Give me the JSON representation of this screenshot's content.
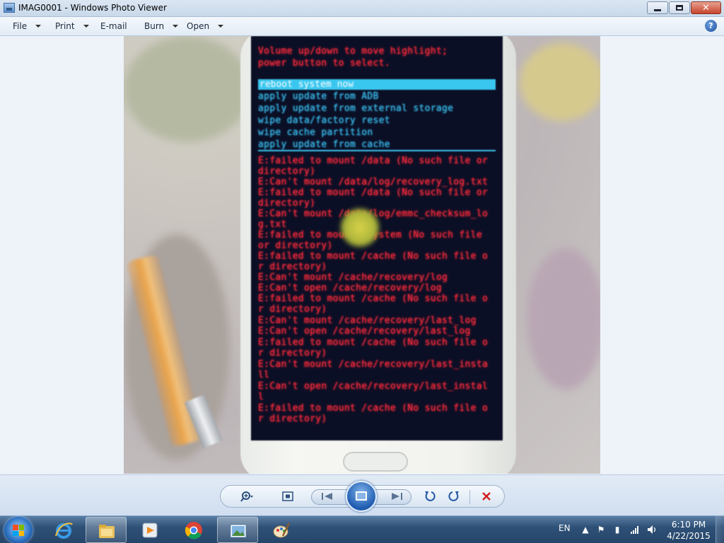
{
  "window": {
    "title": "IMAG0001 - Windows Photo Viewer",
    "icon": "photo-viewer-icon"
  },
  "menu": {
    "items": [
      {
        "label": "File",
        "has_dropdown": true
      },
      {
        "label": "Print",
        "has_dropdown": true
      },
      {
        "label": "E-mail",
        "has_dropdown": false
      },
      {
        "label": "Burn",
        "has_dropdown": true
      },
      {
        "label": "Open",
        "has_dropdown": true
      }
    ],
    "help_glyph": "?"
  },
  "photo": {
    "instructions": [
      "Volume up/down to move highlight;",
      "power button to select."
    ],
    "options": [
      "reboot system now",
      "apply update from ADB",
      "apply update from external storage",
      "wipe data/factory reset",
      "wipe cache partition",
      "apply update from cache"
    ],
    "selected_index": 0,
    "log": [
      "E:failed to mount /data (No such file or",
      "directory)",
      "E:Can't mount /data/log/recovery_log.txt",
      "E:failed to mount /data (No such file or",
      "directory)",
      "E:Can't mount /data/log/emmc_checksum_lo",
      "g.txt",
      "E:failed to mount /system (No such file",
      "or directory)",
      "E:failed to mount /cache (No such file o",
      "r directory)",
      "E:Can't mount /cache/recovery/log",
      "E:Can't open /cache/recovery/log",
      "E:failed to mount /cache (No such file o",
      "r directory)",
      "E:Can't mount /cache/recovery/last_log",
      "E:Can't open /cache/recovery/last_log",
      "E:failed to mount /cache (No such file o",
      "r directory)",
      "E:Can't mount /cache/recovery/last_insta",
      "ll",
      "E:Can't open /cache/recovery/last_instal",
      "l",
      "E:failed to mount /cache (No such file o",
      "r directory)"
    ],
    "colors": {
      "menu_text": "#37b8e8",
      "error_text": "#ff2a3a",
      "highlight": "#3ac7ef"
    }
  },
  "controls": {
    "zoom": "zoom-icon",
    "actual_size": "fit-to-window-icon",
    "previous": "previous-icon",
    "slideshow": "slideshow-icon",
    "next": "next-icon",
    "rotate_ccw": "rotate-counterclockwise-icon",
    "rotate_cw": "rotate-clockwise-icon",
    "delete": "delete-icon"
  },
  "taskbar": {
    "apps": [
      {
        "name": "internet-explorer-icon",
        "active": false
      },
      {
        "name": "windows-explorer-icon",
        "active": true
      },
      {
        "name": "media-player-icon",
        "active": false
      },
      {
        "name": "chrome-icon",
        "active": false
      },
      {
        "name": "photo-viewer-icon",
        "active": true
      },
      {
        "name": "paint-icon",
        "active": false
      }
    ],
    "language": "EN",
    "time": "6:10 PM",
    "date": "4/22/2015"
  }
}
